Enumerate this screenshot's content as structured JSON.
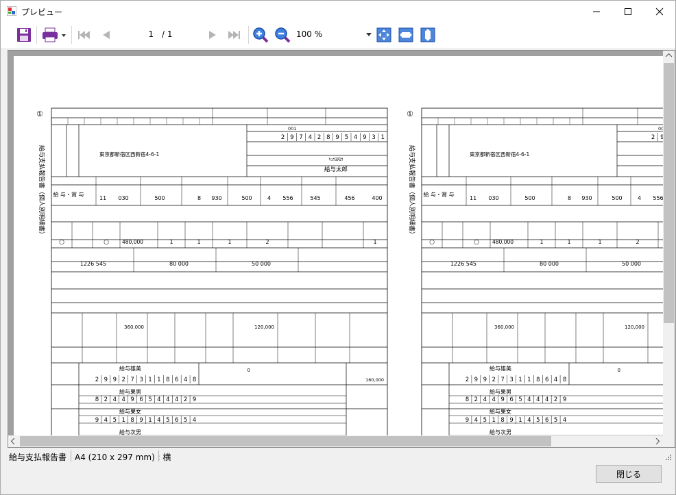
{
  "window": {
    "title": "プレビュー"
  },
  "toolbar": {
    "current_page": "1",
    "total_pages": "/ 1",
    "zoom": "100 %"
  },
  "colors": {
    "accent": "#6a2c8c",
    "toolbar_blue": "#1f5fbf"
  },
  "document": {
    "page_mark": "①",
    "side_title": "給与支払報告書（個人別明細書）",
    "address": "東京都新宿区西新宿4-6-1",
    "person_number_digits": [
      "2",
      "9",
      "7",
      "4",
      "2",
      "8",
      "9",
      "5",
      "4",
      "9",
      "3",
      "1"
    ],
    "number_label": "001",
    "furigana": "ｷｭｳﾖﾀﾛｳ",
    "name": "給与太郎",
    "pay_type": "給 与・賞 与",
    "amounts": {
      "payment_man": "11",
      "payment": "030",
      "payment_yen": "500",
      "deducted_man": "8",
      "deducted": "930",
      "deducted_yen": "500",
      "deduction_total_man": "4",
      "deduction_total": "556",
      "deduction_total_yen": "545",
      "tax_man": "456",
      "tax_yen": "400"
    },
    "dependents": {
      "spouse": "○",
      "elderly": "○",
      "spouse_deduction": "480,000",
      "specific": "1",
      "elderly_dep": "1",
      "elderly_dep2": "1",
      "other": "2",
      "disabled": "1"
    },
    "social_insurance": "1226 545",
    "life_insurance": "80 000",
    "earthquake_insurance": "50 000",
    "insurance_new": "360,000",
    "insurance_pension": "120,000",
    "housing_deduction": "0",
    "other_income": "160,000",
    "spouse_name": "給与雄美",
    "spouse_digits": [
      "2",
      "9",
      "9",
      "2",
      "7",
      "3",
      "1",
      "1",
      "8",
      "6",
      "4",
      "8"
    ],
    "dep1_name": "給与果男",
    "dep1_digits": [
      "8",
      "2",
      "4",
      "4",
      "9",
      "6",
      "5",
      "4",
      "4",
      "4",
      "2",
      "9"
    ],
    "dep2_name": "給与果女",
    "dep2_digits": [
      "9",
      "4",
      "5",
      "1",
      "8",
      "9",
      "1",
      "4",
      "5",
      "6",
      "5",
      "4"
    ],
    "dep3_name": "給与次男"
  },
  "status": {
    "doc_name": "給与支払報告書",
    "paper_size": "A4 (210 x 297 mm) : 横"
  },
  "buttons": {
    "close": "閉じる"
  }
}
